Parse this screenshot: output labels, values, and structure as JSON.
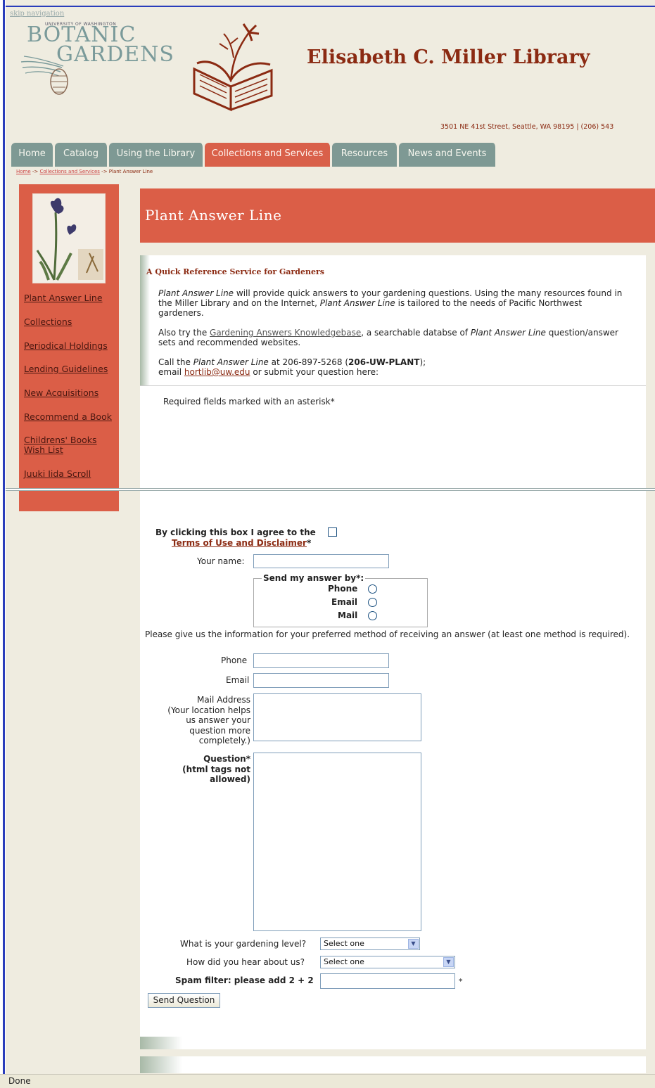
{
  "skip_nav": "skip navigation",
  "logo": {
    "university": "UNIVERSITY OF WASHINGTON",
    "line1": "BOTANIC",
    "line2": "GARDENS"
  },
  "header": {
    "title": "Elisabeth C. Miller Library",
    "address": "3501 NE 41st Street, Seattle, WA 98195 | (206) 543"
  },
  "tabs": [
    {
      "label": "Home"
    },
    {
      "label": "Catalog"
    },
    {
      "label": "Using the Library"
    },
    {
      "label": "Collections and Services"
    },
    {
      "label": "Resources"
    },
    {
      "label": "News and Events"
    }
  ],
  "breadcrumb": {
    "home": "Home",
    "sep1": " -> ",
    "collections": "Collections and Services",
    "sep2": " -> ",
    "current": "Plant Answer Line"
  },
  "sidebar": {
    "items": [
      {
        "label": "Plant Answer Line"
      },
      {
        "label": "Collections"
      },
      {
        "label": "Periodical Holdings"
      },
      {
        "label": "Lending Guidelines"
      },
      {
        "label": "New Acquisitions"
      },
      {
        "label": "Recommend a Book"
      },
      {
        "label": "Childrens' Books"
      },
      {
        "label": "Wish List"
      },
      {
        "label": "Juuki Iida Scroll"
      }
    ]
  },
  "page_title": "Plant Answer Line",
  "section": {
    "heading": "A Quick Reference Service for Gardeners",
    "p1_em1": "Plant Answer Line",
    "p1_a": " will provide quick answers to your gardening questions. Using the many resources found in the Miller Library and on the Internet, ",
    "p1_em2": "Plant Answer Line",
    "p1_b": " is tailored to the needs of Pacific Northwest gardeners.",
    "p2_a": "Also try the ",
    "p2_link": "Gardening Answers Knowledgebase",
    "p2_b": ", a searchable databse of ",
    "p2_em": "Plant Answer Line",
    "p2_c": " question/answer sets and recommended websites.",
    "p3_a": "Call the ",
    "p3_em": "Plant Answer Line",
    "p3_b": " at 206-897-5268 (",
    "p3_strong": "206-UW-PLANT",
    "p3_c": ");",
    "p3_d": "email ",
    "p3_email": "hortlib@uw.edu",
    "p3_e": " or submit your question here:"
  },
  "form": {
    "required_note": "Required fields marked with an asterisk*",
    "agree_line1": "By clicking this box I agree to the",
    "agree_link": "Terms of Use and Disclaimer",
    "agree_star": "*",
    "name_label": "Your name:",
    "send_by_legend": "Send my answer by*:",
    "send_options": [
      "Phone",
      "Email",
      "Mail"
    ],
    "info_note": "Please give us the information for your preferred method of receiving an answer (at least one method is required).",
    "phone_label": "Phone",
    "email_label": "Email",
    "mail_label_lines": [
      "Mail Address",
      "(Your location helps",
      "us answer your",
      "question more",
      "completely.)"
    ],
    "question_label_lines": [
      "Question*",
      "(html tags not",
      "allowed)"
    ],
    "level_label": "What is your gardening level?",
    "level_value": "Select one",
    "hear_label": "How did you hear about us?",
    "hear_value": "Select one",
    "spam_label": "Spam filter: please add 2 + 2",
    "spam_star": "*",
    "submit_label": "Send Question"
  },
  "status_bar": {
    "text": "Done"
  },
  "colors": {
    "accent": "#db5e47",
    "tab": "#7e9994",
    "title_red": "#8b2a12",
    "page_bg": "#efece0"
  }
}
